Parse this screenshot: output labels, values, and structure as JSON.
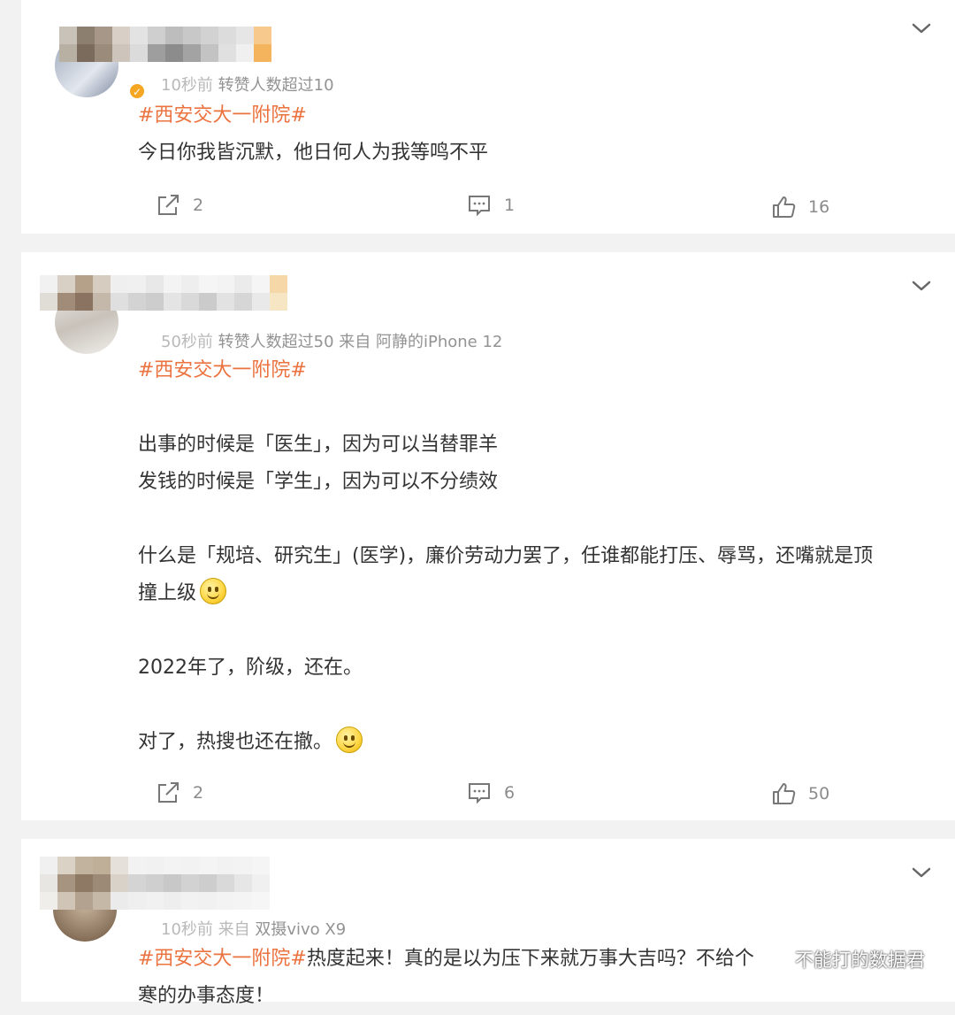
{
  "posts": [
    {
      "meta_visible": "转赞人数超过10",
      "meta_masked": "10秒前 ",
      "hashtag": "#西安交大一附院#",
      "content": [
        "今日你我皆沉默，他日何人为我等鸣不平"
      ],
      "actions": {
        "repost": "2",
        "comment": "1",
        "like": "16"
      }
    },
    {
      "meta_visible": "转赞人数超过50  来自 阿静的iPhone 12",
      "meta_masked": "50秒前 ",
      "hashtag": "#西安交大一附院#",
      "content": [
        "出事的时候是「医生」，因为可以当替罪羊",
        "发钱的时候是「学生」，因为可以不分绩效",
        "什么是「规培、研究生」(医学)，廉价劳动力罢了，任谁都能打压、辱骂，还嘴就是顶",
        "撞上级",
        "2022年了，阶级，还在。",
        "对了，热搜也还在撤。"
      ],
      "actions": {
        "repost": "2",
        "comment": "6",
        "like": "50"
      }
    },
    {
      "meta_visible": "双摄vivo X9",
      "meta_masked": "10秒前 来自 ",
      "hashtag": "#西安交大一附院#",
      "content": [
        "热度起来！真的是以为压下来就万事大吉吗？不给个",
        "寒的办事态度！"
      ],
      "actions": {}
    }
  ],
  "watermark": "不能打的数据君",
  "colors": {
    "hashtag": "#eb7340",
    "text": "#333333",
    "meta": "#939393",
    "background": "#f2f2f2"
  },
  "icons": [
    "chevron-down-icon",
    "repost-icon",
    "comment-icon",
    "like-icon",
    "verified-badge-icon",
    "smiley-emoji",
    "wechat-logo-icon"
  ]
}
